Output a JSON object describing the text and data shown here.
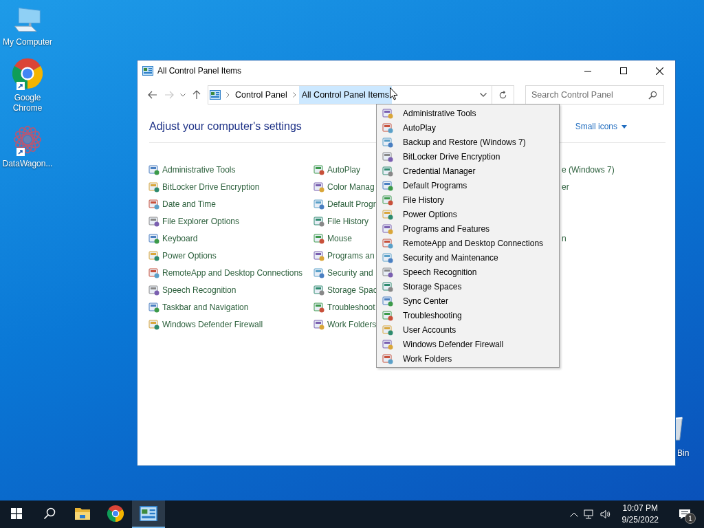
{
  "desktop_icons": [
    {
      "label": "My Computer",
      "kind": "computer"
    },
    {
      "label": "Google Chrome",
      "kind": "chrome"
    },
    {
      "label": "DataWagon...",
      "kind": "app"
    }
  ],
  "recycle_bin": {
    "label": "Bin"
  },
  "window": {
    "title": "All Control Panel Items",
    "breadcrumbs": [
      {
        "label": "Control Panel",
        "selected": false
      },
      {
        "label": "All Control Panel Items",
        "selected": true
      }
    ],
    "search": {
      "placeholder": "Search Control Panel"
    },
    "heading": "Adjust your computer's settings",
    "view_by": "Small icons",
    "rows": [
      [
        "Administrative Tools",
        "AutoPlay",
        "e (Windows 7)"
      ],
      [
        "BitLocker Drive Encryption",
        "Color Manag",
        "er"
      ],
      [
        "Date and Time",
        "Default Progr",
        null
      ],
      [
        "File Explorer Options",
        "File History",
        null
      ],
      [
        "Keyboard",
        "Mouse",
        "n"
      ],
      [
        "Power Options",
        "Programs an",
        null
      ],
      [
        "RemoteApp and Desktop Connections",
        "Security and",
        null
      ],
      [
        "Speech Recognition",
        "Storage Spac",
        null
      ],
      [
        "Taskbar and Navigation",
        "Troubleshoot",
        null
      ],
      [
        "Windows Defender Firewall",
        "Work Folders",
        null
      ]
    ]
  },
  "address_dropdown": {
    "items": [
      "Administrative Tools",
      "AutoPlay",
      "Backup and Restore (Windows 7)",
      "BitLocker Drive Encryption",
      "Credential Manager",
      "Default Programs",
      "File History",
      "Power Options",
      "Programs and Features",
      "RemoteApp and Desktop Connections",
      "Security and Maintenance",
      "Speech Recognition",
      "Storage Spaces",
      "Sync Center",
      "Troubleshooting",
      "User Accounts",
      "Windows Defender Firewall",
      "Work Folders"
    ]
  },
  "taskbar": {
    "apps": [
      {
        "kind": "start",
        "selected": false
      },
      {
        "kind": "search",
        "selected": false
      },
      {
        "kind": "explorer",
        "selected": false
      },
      {
        "kind": "chrome",
        "selected": false
      },
      {
        "kind": "control-panel",
        "selected": true
      }
    ],
    "clock": {
      "time": "10:07 PM",
      "date": "9/25/2022"
    },
    "notifications": {
      "count": "1"
    }
  }
}
